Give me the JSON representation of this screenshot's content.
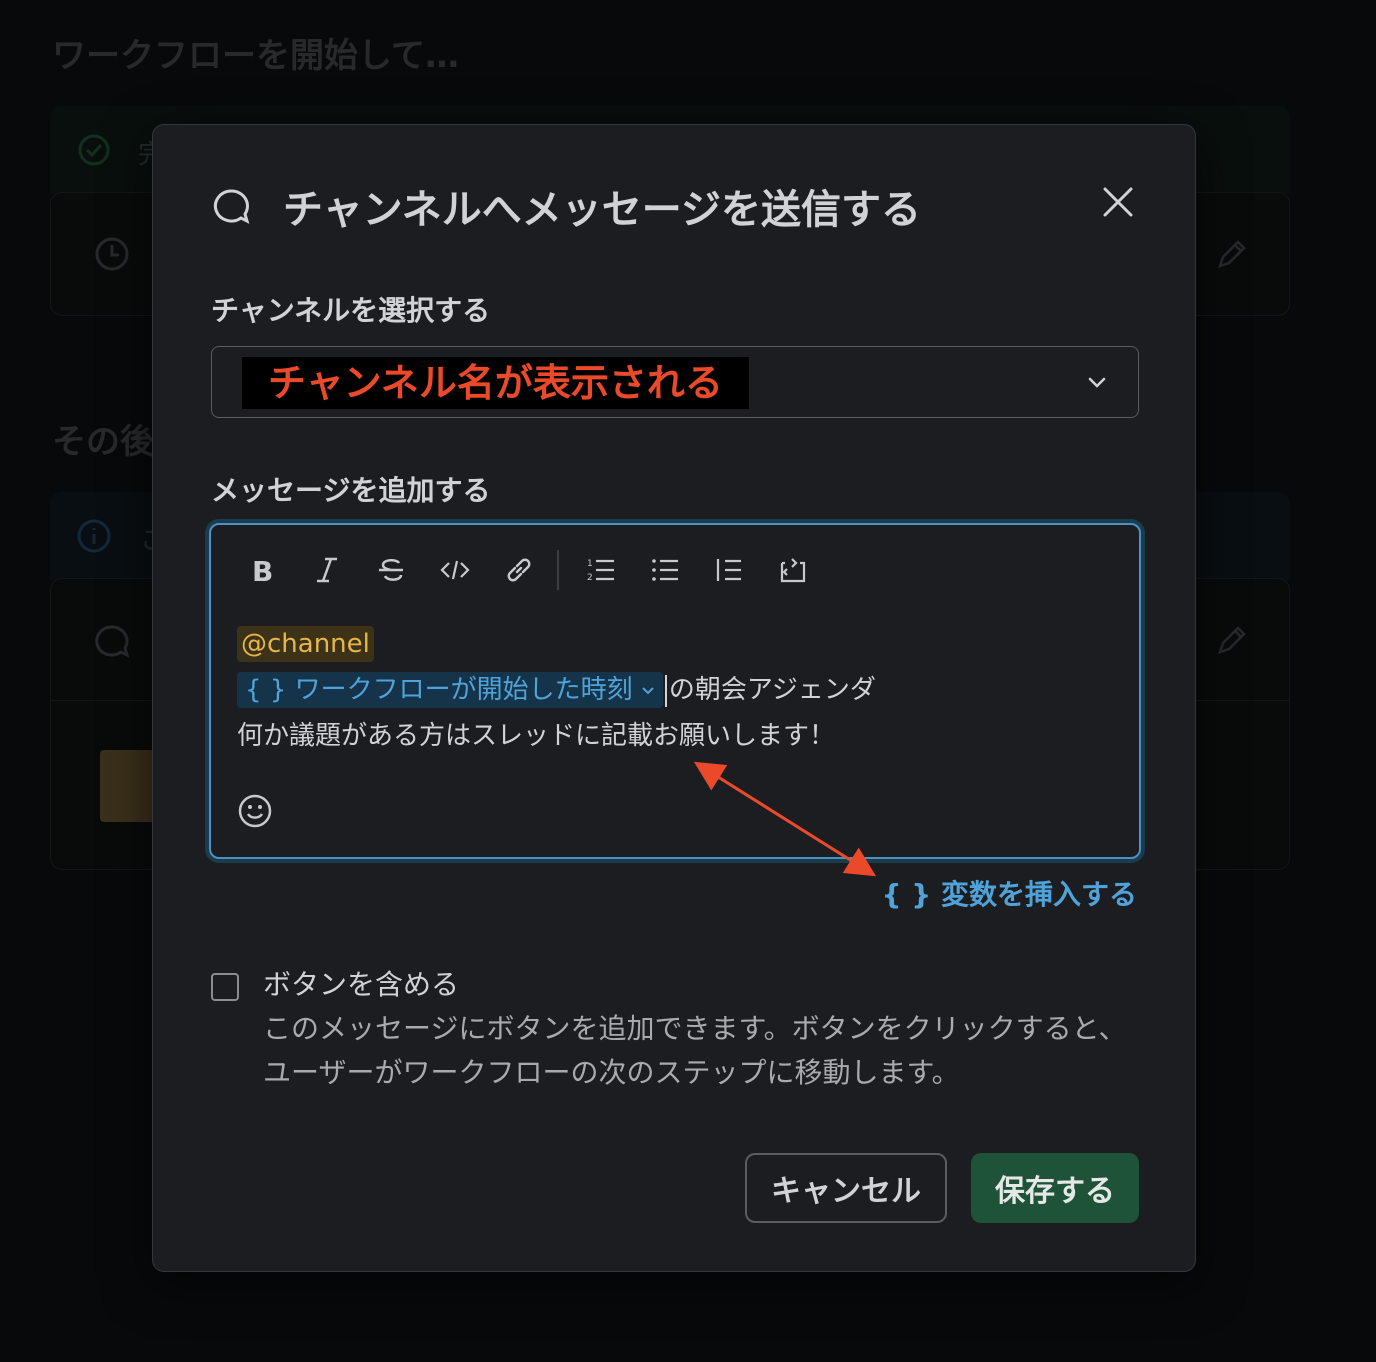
{
  "background": {
    "heading": "ワークフローを開始して…",
    "status_text": "完",
    "section_heading": "その後",
    "info_text": "こ"
  },
  "modal": {
    "title": "チャンネルへメッセージを送信する",
    "icon": "message-bubble-icon",
    "close_icon": "close-icon",
    "channel_label": "チャンネルを選択する",
    "channel_value": "チャンネル名が表示される",
    "message_label": "メッセージを追加する",
    "toolbar": {
      "items": [
        "bold-icon",
        "italic-icon",
        "strikethrough-icon",
        "code-icon",
        "link-icon",
        "ordered-list-icon",
        "bulleted-list-icon",
        "blockquote-icon",
        "code-block-icon"
      ]
    },
    "message": {
      "mention": "@channel",
      "variable": "{ } ワークフローが開始した時刻",
      "variable_suffix": "の朝会アジェンダ",
      "line3": "何か議題がある方はスレッドに記載お願いします！"
    },
    "insert_variable": "{ } 変数を挿入する",
    "include_button_label": "ボタンを含める",
    "include_button_desc": "このメッセージにボタンを追加できます。ボタンをクリックすると、ユーザーがワークフローの次のステップに移動します。",
    "include_button_checked": false,
    "cancel_label": "キャンセル",
    "save_label": "保存する",
    "colors": {
      "accent_blue": "#4fa3d9",
      "save_green": "#1f5339",
      "annotation_red": "#ea4a2a",
      "mention_yellow": "#e8b54a"
    }
  }
}
